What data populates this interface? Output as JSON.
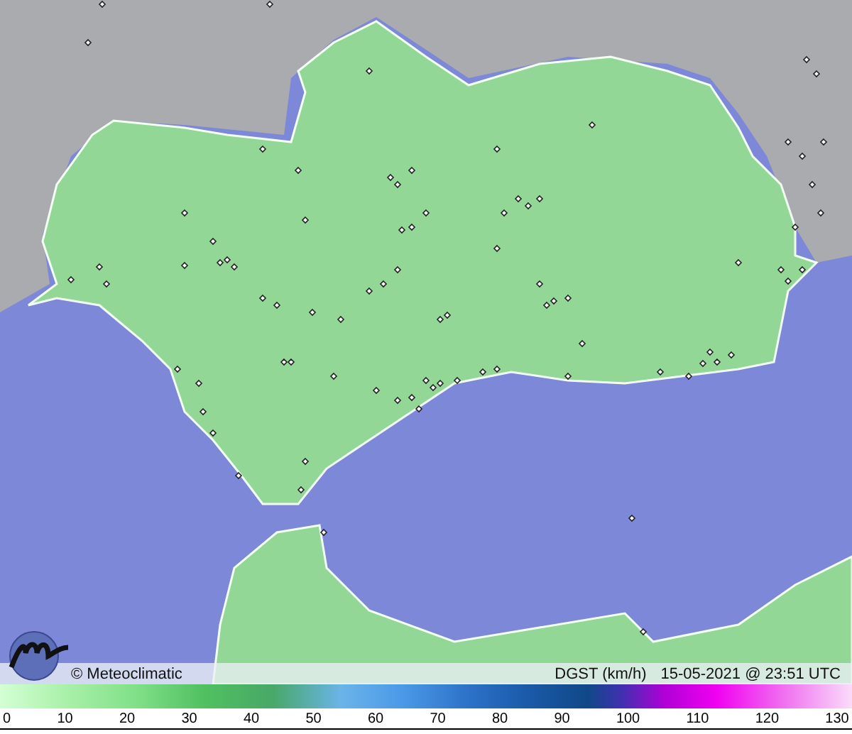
{
  "map": {
    "attribution": "© Meteoclimatic",
    "variable": "DGST (km/h)",
    "timestamp": "15-05-2021 @ 23:51 UTC"
  },
  "legend": {
    "ticks": [
      "0",
      "10",
      "20",
      "30",
      "40",
      "50",
      "60",
      "70",
      "80",
      "90",
      "100",
      "110",
      "120",
      "130"
    ]
  }
}
